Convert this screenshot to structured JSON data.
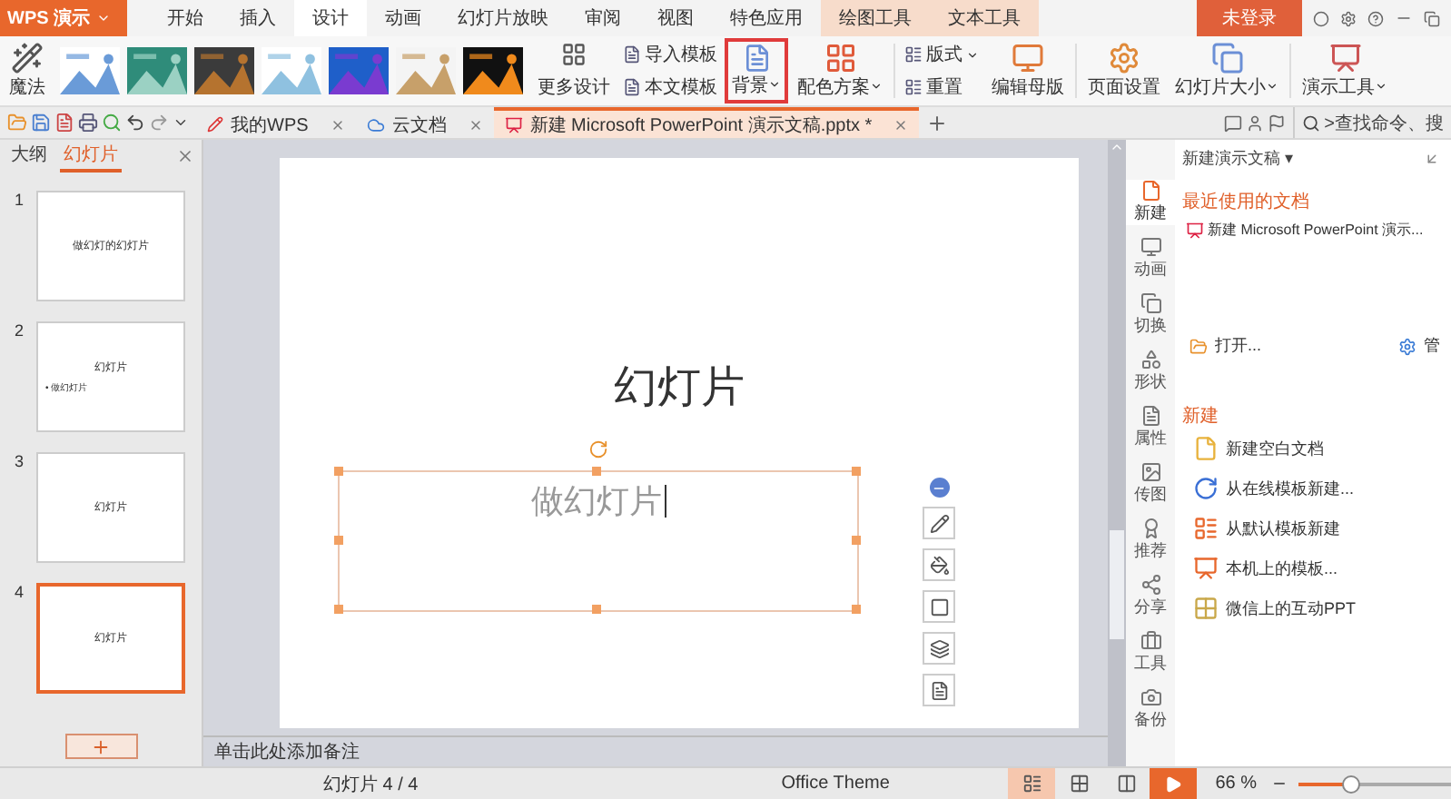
{
  "app_menu": {
    "label": "WPS 演示"
  },
  "ribbon_tabs": [
    {
      "label": "开始",
      "selected": false,
      "kind": "normal"
    },
    {
      "label": "插入",
      "selected": false,
      "kind": "normal"
    },
    {
      "label": "设计",
      "selected": true,
      "kind": "normal"
    },
    {
      "label": "动画",
      "selected": false,
      "kind": "normal"
    },
    {
      "label": "幻灯片放映",
      "selected": false,
      "kind": "normal"
    },
    {
      "label": "审阅",
      "selected": false,
      "kind": "normal"
    },
    {
      "label": "视图",
      "selected": false,
      "kind": "normal"
    },
    {
      "label": "特色应用",
      "selected": false,
      "kind": "normal"
    },
    {
      "label": "绘图工具",
      "selected": false,
      "kind": "context"
    },
    {
      "label": "文本工具",
      "selected": false,
      "kind": "context"
    }
  ],
  "account": {
    "label": "未登录"
  },
  "ribbon": {
    "magic": "魔法",
    "more_designs": "更多设计",
    "stack_1": [
      {
        "label": "导入模板",
        "dropdown": false
      },
      {
        "label": "本文模板",
        "dropdown": false
      }
    ],
    "large_1": [
      {
        "label": "背景",
        "dropdown": true,
        "highlighted": true
      },
      {
        "label": "配色方案",
        "dropdown": true,
        "highlighted": false
      }
    ],
    "stack_2": [
      {
        "label": "版式",
        "dropdown": true
      },
      {
        "label": "重置",
        "dropdown": false
      }
    ],
    "large_2": [
      {
        "label": "编辑母版",
        "dropdown": false,
        "highlighted": false
      },
      {
        "label": "页面设置",
        "dropdown": false,
        "highlighted": false
      },
      {
        "label": "幻灯片大小",
        "dropdown": true,
        "highlighted": false
      },
      {
        "label": "演示工具",
        "dropdown": true,
        "highlighted": false
      }
    ]
  },
  "doc_tabs": [
    {
      "label": "我的WPS",
      "selected": false,
      "kind": "wps"
    },
    {
      "label": "云文档",
      "selected": false,
      "kind": "cloud"
    },
    {
      "label": "新建 Microsoft PowerPoint 演示文稿.pptx *",
      "selected": true,
      "kind": "pptx"
    }
  ],
  "search": {
    "placeholder": ">查找命令、搜"
  },
  "slide_panel": {
    "tabs": [
      {
        "label": "大纲",
        "selected": false
      },
      {
        "label": "幻灯片",
        "selected": true
      }
    ],
    "slides": [
      {
        "number": "1",
        "selected": false,
        "title": "做幻灯的幻灯片"
      },
      {
        "number": "2",
        "selected": false,
        "title": "幻灯片",
        "bullet": "• 做幻灯片"
      },
      {
        "number": "3",
        "selected": false,
        "title": "幻灯片"
      },
      {
        "number": "4",
        "selected": true,
        "title": "幻灯片"
      }
    ]
  },
  "slide": {
    "title": "幻灯片",
    "body": "做幻灯片",
    "editing": true
  },
  "notes": {
    "placeholder": "单击此处添加备注"
  },
  "side_bar": [
    {
      "label": "新建",
      "selected": true
    },
    {
      "label": "动画",
      "selected": false
    },
    {
      "label": "切换",
      "selected": false
    },
    {
      "label": "形状",
      "selected": false
    },
    {
      "label": "属性",
      "selected": false
    },
    {
      "label": "传图",
      "selected": false
    },
    {
      "label": "推荐",
      "selected": false
    },
    {
      "label": "分享",
      "selected": false
    },
    {
      "label": "工具",
      "selected": false
    },
    {
      "label": "备份",
      "selected": false
    }
  ],
  "task_pane": {
    "title": "新建演示文稿 ▾",
    "recent_heading": "最近使用的文档",
    "recent": [
      "新建 Microsoft PowerPoint 演示..."
    ],
    "open": "打开...",
    "manage": "管",
    "new_heading": "新建",
    "new_items": [
      "新建空白文档",
      "从在线模板新建...",
      "从默认模板新建",
      "本机上的模板...",
      "微信上的互动PPT"
    ]
  },
  "status_bar": {
    "slide_counter": "幻灯片 4 / 4",
    "theme": "Office Theme",
    "views": [
      {
        "selected": true
      },
      {
        "selected": false
      },
      {
        "selected": false
      }
    ],
    "zoom": "66 %",
    "zoom_level": {
      "level": 0.35
    }
  }
}
